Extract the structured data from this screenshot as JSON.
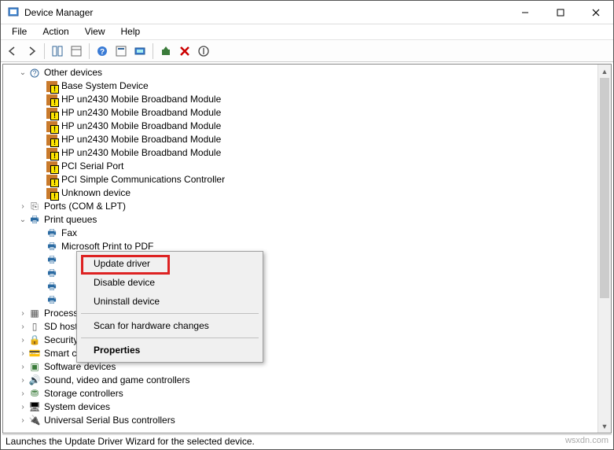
{
  "window": {
    "title": "Device Manager"
  },
  "menus": {
    "file": "File",
    "action": "Action",
    "view": "View",
    "help": "Help"
  },
  "tree": {
    "other_devices": {
      "label": "Other devices",
      "children": [
        "Base System Device",
        "HP un2430 Mobile Broadband Module",
        "HP un2430 Mobile Broadband Module",
        "HP un2430 Mobile Broadband Module",
        "HP un2430 Mobile Broadband Module",
        "HP un2430 Mobile Broadband Module",
        "PCI Serial Port",
        "PCI Simple Communications Controller",
        "Unknown device"
      ]
    },
    "ports": "Ports (COM & LPT)",
    "print_queues": {
      "label": "Print queues",
      "children": [
        "Fax",
        "Microsoft Print to PDF",
        "",
        "",
        "",
        ""
      ]
    },
    "processors": "Processors",
    "sdhost": "SD host adapters",
    "security": "Security devices",
    "smartcard": "Smart card readers",
    "software": "Software devices",
    "sound": "Sound, video and game controllers",
    "storage": "Storage controllers",
    "system": "System devices",
    "usb": "Universal Serial Bus controllers"
  },
  "context_menu": {
    "update": "Update driver",
    "disable": "Disable device",
    "uninstall": "Uninstall device",
    "scan": "Scan for hardware changes",
    "properties": "Properties"
  },
  "status": "Launches the Update Driver Wizard for the selected device.",
  "watermark": "wsxdn.com"
}
